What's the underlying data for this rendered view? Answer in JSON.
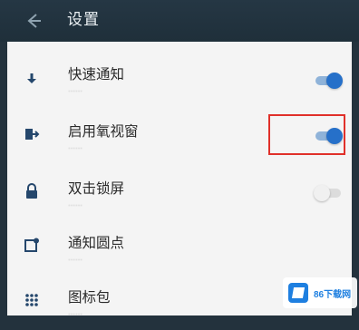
{
  "header": {
    "back_icon": "arrow-left-icon",
    "title": "设置"
  },
  "settings": [
    {
      "label": "快速通知",
      "subtitle": "……",
      "icon": "download-arrow-icon",
      "toggle": "on"
    },
    {
      "label": "启用氧视窗",
      "subtitle": "……",
      "icon": "exit-door-icon",
      "toggle": "on"
    },
    {
      "label": "双击锁屏",
      "subtitle": "……",
      "icon": "lock-icon",
      "toggle": "off"
    },
    {
      "label": "通知圆点",
      "subtitle": "……",
      "icon": "badge-dot-icon",
      "toggle": null
    },
    {
      "label": "图标包",
      "subtitle": "……",
      "icon": "grid-icon",
      "toggle": null
    }
  ],
  "watermark": {
    "text": "86下载网"
  },
  "colors": {
    "accent": "#2670c9",
    "highlight": "#e0302a",
    "topbar": "#23323d"
  }
}
